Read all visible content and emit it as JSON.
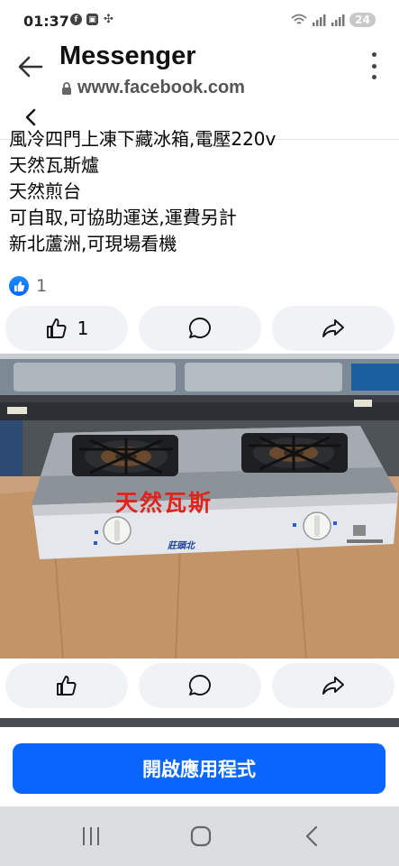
{
  "status_bar": {
    "time": "01:37",
    "battery": "24"
  },
  "header": {
    "title": "Messenger",
    "url": "www.facebook.com"
  },
  "post": {
    "lines": [
      "風冷四門上凍下藏冰箱,電壓220v",
      "天然瓦斯爐",
      "天然煎台",
      "可自取,可協助運送,運費另計",
      "新北蘆洲,可現場看機"
    ],
    "reaction_count": "1",
    "like_count": "1"
  },
  "photo": {
    "watermark": "天然瓦斯",
    "brand": "莊頭北"
  },
  "cta": {
    "label": "開啟應用程式"
  },
  "colors": {
    "accent": "#0866ff",
    "button_bg": "#f0f2f5",
    "nav_bg": "#dcdde0"
  }
}
